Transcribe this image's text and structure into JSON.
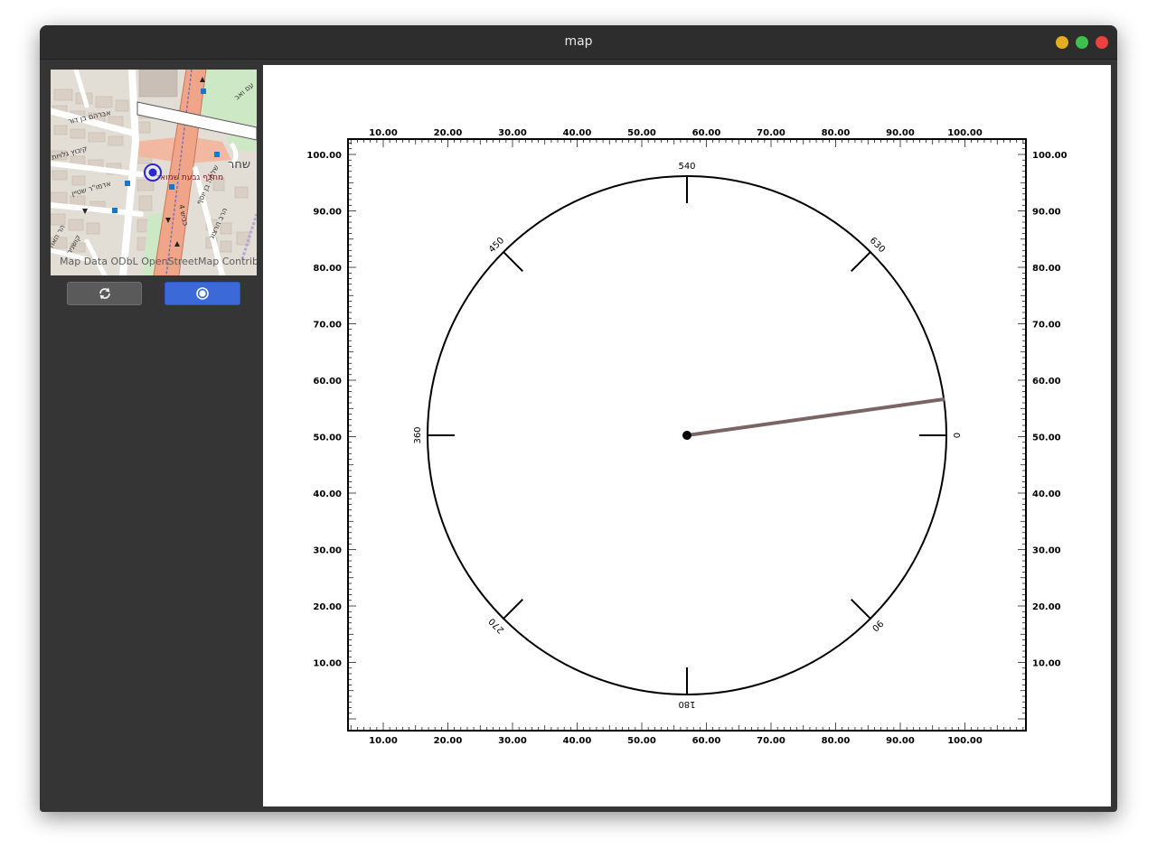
{
  "window": {
    "title": "map"
  },
  "map": {
    "attribution": "Map Data ODbL OpenStreetMap Contribu",
    "labels": {
      "station": "מחלף גבעת שמואל",
      "street_ben_dor": "אברהם בן דור",
      "street_kibbutz": "קיבוץ גלויות",
      "street_adoni": "אדמו\"ר שטיין",
      "street_begin": "כביש 4",
      "street_shlomo": "שלמה בן יוסף",
      "street_harav": "הרב הרצוג",
      "street_shachar": "שחר",
      "street_am": "עם ואב",
      "street_kosher": "קושניר",
      "street_harav2": "הר האח"
    }
  },
  "buttons": {
    "refresh_icon": "refresh-icon",
    "locate_icon": "locate-icon"
  },
  "compass": {
    "x_ticks": [
      "10.00",
      "20.00",
      "30.00",
      "40.00",
      "50.00",
      "60.00",
      "70.00",
      "80.00",
      "90.00",
      "100.00"
    ],
    "y_ticks": [
      "100.00",
      "90.00",
      "80.00",
      "70.00",
      "60.00",
      "50.00",
      "40.00",
      "30.00",
      "20.00",
      "10.00"
    ],
    "dial_labels": [
      "0",
      "90",
      "180",
      "270",
      "360",
      "450",
      "540",
      "630"
    ],
    "needle_heading": 352,
    "needle_color": "#7a6464"
  }
}
